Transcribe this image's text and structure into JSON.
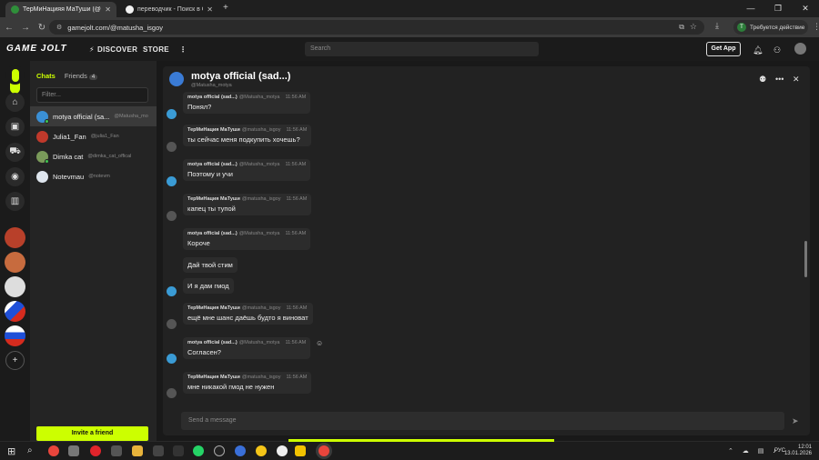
{
  "browser": {
    "tabs": [
      {
        "title": "ТерМиНацияя МаТуши (@mati",
        "active": true,
        "favicon_color": "#2f8f3a"
      },
      {
        "title": "переводчик - Поиск в Google",
        "active": false,
        "favicon_color": "#f2f2f2"
      }
    ],
    "new_tab": "+",
    "url": "gamejolt.com/@matusha_isgoy",
    "action_pill": {
      "avatar": "T",
      "label": "Требуется действие"
    },
    "window_controls": [
      "—",
      "❐",
      "✕"
    ]
  },
  "site": {
    "logo": "GAME JOLT",
    "nav": {
      "discover": "DISCOVER",
      "store": "STORE"
    },
    "search_placeholder": "Search",
    "get_app": "Get App",
    "accent": "#ccff00"
  },
  "chats_panel": {
    "tab_chats": "Chats",
    "tab_friends": "Friends",
    "friends_count": "4",
    "filter_placeholder": "Filter...",
    "rows": [
      {
        "name": "motya official (sa...",
        "handle": "@Matusha_mo",
        "selected": true,
        "online": true,
        "avatar_color": "#3a8fd5"
      },
      {
        "name": "Julia1_Fan",
        "handle": "@julia1_Fan",
        "selected": false,
        "online": false,
        "avatar_color": "#c0392b"
      },
      {
        "name": "Dimka cat",
        "handle": "@dimka_cat_offical",
        "selected": false,
        "online": true,
        "avatar_color": "#7a9a5a"
      },
      {
        "name": "Notevmau",
        "handle": "@notevm",
        "selected": false,
        "online": false,
        "avatar_color": "#dfe6ee"
      }
    ],
    "invite_label": "Invite a friend"
  },
  "chat": {
    "title": "motya official (sad...)",
    "subtitle": "@Matusha_motya",
    "compose_placeholder": "Send a message",
    "messages": [
      {
        "author": "motya official (sad...)",
        "handle": "@Matusha_motya",
        "time": "11:56 AM",
        "text": "Понял?",
        "who": "m"
      },
      {
        "author": "ТерМиНация МаТуши",
        "handle": "@matusha_isgoy",
        "time": "11:56 AM",
        "text": "ты сейчас меня подкупить хочешь?",
        "who": "s"
      },
      {
        "author": "motya official (sad...)",
        "handle": "@Matusha_motya",
        "time": "11:56 AM",
        "text": "Поэтому и учи",
        "who": "m"
      },
      {
        "author": "ТерМиНация МаТуши",
        "handle": "@matusha_isgoy",
        "time": "11:56 AM",
        "text": "капец ты тупой",
        "who": "s"
      },
      {
        "author": "motya official (sad...)",
        "handle": "@Matusha_motya",
        "time": "11:56 AM",
        "text": "Короче",
        "who": "m"
      },
      {
        "author": "",
        "handle": "",
        "time": "",
        "text": "Дай твой стим",
        "who": "m"
      },
      {
        "author": "",
        "handle": "",
        "time": "",
        "text": "И я дам гмод",
        "who": "m"
      },
      {
        "author": "ТерМиНация МаТуши",
        "handle": "@matusha_isgoy",
        "time": "11:56 AM",
        "text": "ещё мне шанс даёшь будто я виноват",
        "who": "s"
      },
      {
        "author": "motya official (sad...)",
        "handle": "@Matusha_motya",
        "time": "11:56 AM",
        "text": "Согласен?",
        "who": "m"
      },
      {
        "author": "ТерМиНация МаТуши",
        "handle": "@matusha_isgoy",
        "time": "11:56 AM",
        "text": "мне никакой гмод не нужен",
        "who": "s"
      }
    ]
  },
  "taskbar": {
    "lang": "РУС",
    "time": "12:01",
    "date": "13.01.2026"
  }
}
